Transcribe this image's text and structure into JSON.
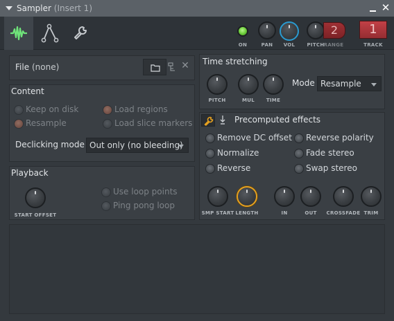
{
  "window": {
    "title": "Sampler",
    "subtitle": "(Insert 1)"
  },
  "toolbar": {
    "tabs": [
      {
        "icon": "waveform-icon"
      },
      {
        "icon": "envelope-icon"
      },
      {
        "icon": "wrench-icon"
      }
    ],
    "on_label": "ON",
    "pan_label": "PAN",
    "vol_label": "VOL",
    "pitch_label": "PITCH",
    "range_label": "RANGE",
    "range_value": "2",
    "track_label": "TRACK",
    "track_value": "1",
    "colors": {
      "on_led": "#7ee04a",
      "vol_ring": "#2a9ad0",
      "track_bg": "#b6393c"
    }
  },
  "file": {
    "label": "File",
    "value": "(none)"
  },
  "content": {
    "title": "Content",
    "options": [
      {
        "label": "Keep on disk",
        "checked": false,
        "enabled": false
      },
      {
        "label": "Load regions",
        "checked": true,
        "enabled": false
      },
      {
        "label": "Resample",
        "checked": true,
        "enabled": false
      },
      {
        "label": "Load slice markers",
        "checked": false,
        "enabled": false
      }
    ],
    "declicking_label": "Declicking mode",
    "declicking_value": "Out only (no bleeding)"
  },
  "playback": {
    "title": "Playback",
    "start_offset_label": "START OFFSET",
    "options": [
      {
        "label": "Use loop points",
        "enabled": false
      },
      {
        "label": "Ping pong loop",
        "enabled": false
      }
    ]
  },
  "time_stretching": {
    "title": "Time stretching",
    "knobs": [
      "PITCH",
      "MUL",
      "TIME"
    ],
    "mode_label": "Mode",
    "mode_value": "Resample"
  },
  "precomputed": {
    "title": "Precomputed effects",
    "options_left": [
      "Remove DC offset",
      "Normalize",
      "Reverse"
    ],
    "options_right": [
      "Reverse polarity",
      "Fade stereo",
      "Swap stereo"
    ],
    "knobs": [
      "SMP START",
      "LENGTH",
      "IN",
      "OUT",
      "CROSSFADE",
      "TRIM"
    ],
    "accent": "#e6a11f"
  }
}
